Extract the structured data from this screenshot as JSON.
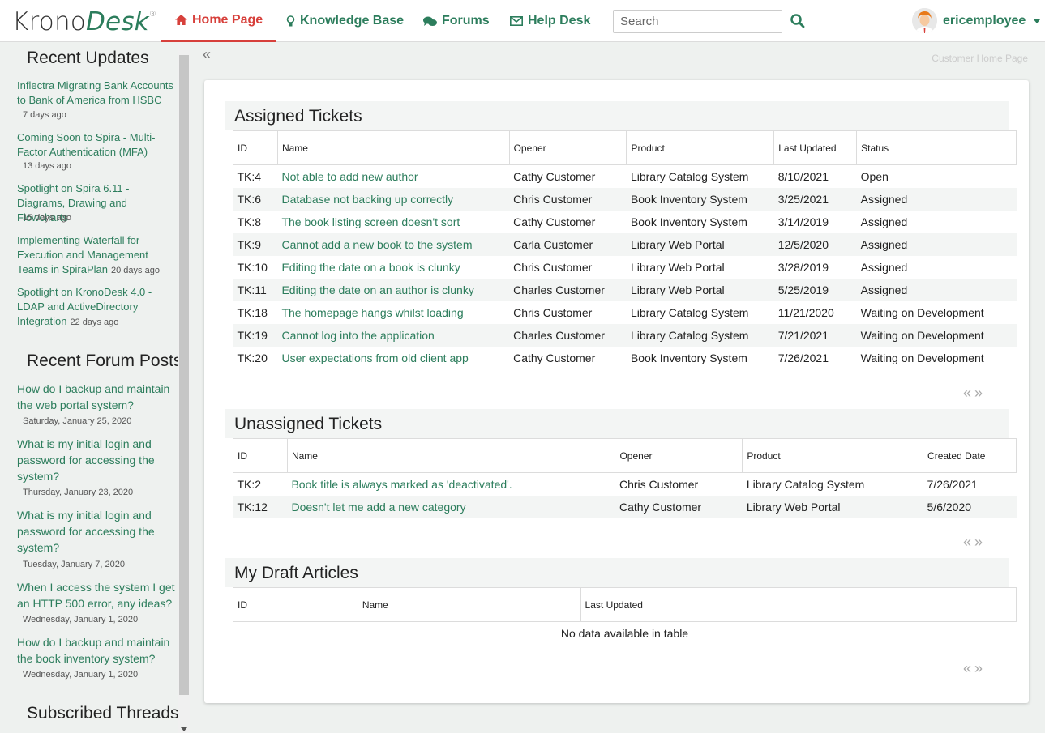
{
  "app": {
    "logo_left": "Krono",
    "logo_right": "Desk",
    "logo_mark": "®"
  },
  "nav": {
    "items": [
      {
        "label": "Home Page",
        "icon": "home-icon"
      },
      {
        "label": "Knowledge Base",
        "icon": "lightbulb-icon"
      },
      {
        "label": "Forums",
        "icon": "comments-icon"
      },
      {
        "label": "Help Desk",
        "icon": "envelope-icon"
      }
    ]
  },
  "search": {
    "placeholder": "Search",
    "value": ""
  },
  "user": {
    "name": "ericemployee"
  },
  "breadcrumb": "Customer Home Page",
  "sidebar": {
    "updates_title": "Recent Updates",
    "updates": [
      {
        "title": "Inflectra Migrating Bank Accounts to Bank of America from HSBC",
        "age": "7 days ago"
      },
      {
        "title": "Coming Soon to Spira - Multi-Factor Authentication (MFA)",
        "age": "13 days ago"
      },
      {
        "title": "Spotlight on Spira 6.11 - Diagrams, Drawing and Flowcharts",
        "age": "15 days ago"
      },
      {
        "title": "Implementing Waterfall for Execution and Management Teams in SpiraPlan",
        "age": "20 days ago"
      },
      {
        "title": "Spotlight on KronoDesk 4.0 - LDAP and ActiveDirectory Integration",
        "age": "22 days ago"
      }
    ],
    "forums_title": "Recent Forum Posts",
    "forums": [
      {
        "title": "How do I backup and maintain the web portal system?",
        "date": "Saturday, January 25, 2020"
      },
      {
        "title": "What is my initial login and password for accessing the system?",
        "date": "Thursday, January 23, 2020"
      },
      {
        "title": "What is my initial login and password for accessing the system?",
        "date": "Tuesday, January 7, 2020"
      },
      {
        "title": "When I access the system I get an HTTP 500 error, any ideas?",
        "date": "Wednesday, January 1, 2020"
      },
      {
        "title": "How do I backup and maintain the book inventory system?",
        "date": "Wednesday, January 1, 2020"
      }
    ],
    "subscribed_title": "Subscribed Threads"
  },
  "assigned": {
    "title": "Assigned Tickets",
    "headers": [
      "ID",
      "Name",
      "Opener",
      "Product",
      "Last Updated",
      "Status"
    ],
    "rows": [
      [
        "TK:4",
        "Not able to add new author",
        "Cathy Customer",
        "Library Catalog System",
        "8/10/2021",
        "Open"
      ],
      [
        "TK:6",
        "Database not backing up correctly",
        "Chris Customer",
        "Book Inventory System",
        "3/25/2021",
        "Assigned"
      ],
      [
        "TK:8",
        "The book listing screen doesn't sort",
        "Cathy Customer",
        "Book Inventory System",
        "3/14/2019",
        "Assigned"
      ],
      [
        "TK:9",
        "Cannot add a new book to the system",
        "Carla Customer",
        "Library Web Portal",
        "12/5/2020",
        "Assigned"
      ],
      [
        "TK:10",
        "Editing the date on a book is clunky",
        "Chris Customer",
        "Library Web Portal",
        "3/28/2019",
        "Assigned"
      ],
      [
        "TK:11",
        "Editing the date on an author is clunky",
        "Charles Customer",
        "Library Web Portal",
        "5/25/2019",
        "Assigned"
      ],
      [
        "TK:18",
        "The homepage hangs whilst loading",
        "Chris Customer",
        "Library Catalog System",
        "11/21/2020",
        "Waiting on Development"
      ],
      [
        "TK:19",
        "Cannot log into the application",
        "Charles Customer",
        "Library Catalog System",
        "7/21/2021",
        "Waiting on Development"
      ],
      [
        "TK:20",
        "User expectations from old client app",
        "Cathy Customer",
        "Book Inventory System",
        "7/26/2021",
        "Waiting on Development"
      ]
    ]
  },
  "unassigned": {
    "title": "Unassigned Tickets",
    "headers": [
      "ID",
      "Name",
      "Opener",
      "Product",
      "Created Date"
    ],
    "rows": [
      [
        "TK:2",
        "Book title is always marked as 'deactivated'.",
        "Chris Customer",
        "Library Catalog System",
        "7/26/2021"
      ],
      [
        "TK:12",
        "Doesn't let me add a new category",
        "Cathy Customer",
        "Library Web Portal",
        "5/6/2020"
      ]
    ]
  },
  "drafts": {
    "title": "My Draft Articles",
    "headers": [
      "ID",
      "Name",
      "Last Updated"
    ],
    "empty_text": "No data available in table"
  },
  "pager": {
    "prev": "«",
    "next": "»"
  },
  "colors": {
    "accent": "#2c7d5c",
    "active": "#d7403b"
  }
}
